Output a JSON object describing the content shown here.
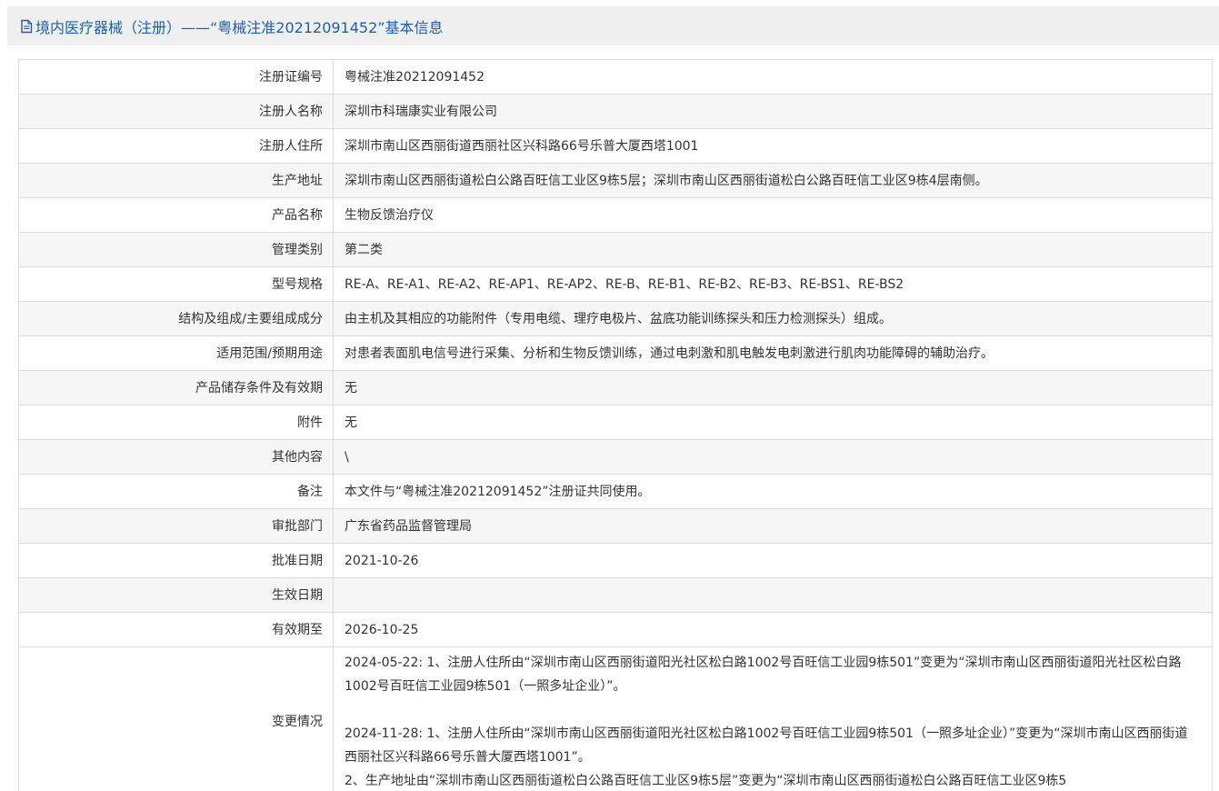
{
  "header": {
    "icon": "document-icon",
    "title": "境内医疗器械（注册）——“粤械注准20212091452”基本信息"
  },
  "rows": [
    {
      "label": "注册证编号",
      "value": "粤械注准20212091452"
    },
    {
      "label": "注册人名称",
      "value": "深圳市科瑞康实业有限公司"
    },
    {
      "label": "注册人住所",
      "value": "深圳市南山区西丽街道西丽社区兴科路66号乐普大厦西塔1001"
    },
    {
      "label": "生产地址",
      "value": "深圳市南山区西丽街道松白公路百旺信工业区9栋5层；深圳市南山区西丽街道松白公路百旺信工业区9栋4层南侧。"
    },
    {
      "label": "产品名称",
      "value": "生物反馈治疗仪"
    },
    {
      "label": "管理类别",
      "value": "第二类"
    },
    {
      "label": "型号规格",
      "value": "RE-A、RE-A1、RE-A2、RE-AP1、RE-AP2、RE-B、RE-B1、RE-B2、RE-B3、RE-BS1、RE-BS2"
    },
    {
      "label": "结构及组成/主要组成成分",
      "value": "由主机及其相应的功能附件（专用电缆、理疗电极片、盆底功能训练探头和压力检测探头）组成。"
    },
    {
      "label": "适用范围/预期用途",
      "value": "对患者表面肌电信号进行采集、分析和生物反馈训练，通过电刺激和肌电触发电刺激进行肌肉功能障碍的辅助治疗。"
    },
    {
      "label": "产品储存条件及有效期",
      "value": "无"
    },
    {
      "label": "附件",
      "value": "无"
    },
    {
      "label": "其他内容",
      "value": "\\"
    },
    {
      "label": "备注",
      "value": "本文件与“粤械注准20212091452”注册证共同使用。"
    },
    {
      "label": "审批部门",
      "value": "广东省药品监督管理局"
    },
    {
      "label": "批准日期",
      "value": "2021-10-26"
    },
    {
      "label": "生效日期",
      "value": ""
    },
    {
      "label": "有效期至",
      "value": "2026-10-25"
    }
  ],
  "changes": {
    "label": "变更情况",
    "entries": [
      "2024-05-22: 1、注册人住所由“深圳市南山区西丽街道阳光社区松白路1002号百旺信工业园9栋501”变更为“深圳市南山区西丽街道阳光社区松白路1002号百旺信工业园9栋501（一照多址企业）”。",
      "2024-11-28: 1、注册人住所由“深圳市南山区西丽街道阳光社区松白路1002号百旺信工业园9栋501（一照多址企业）”变更为“深圳市南山区西丽街道西丽社区兴科路66号乐普大厦西塔1001”。",
      "2、生产地址由“深圳市南山区西丽街道松白公路百旺信工业区9栋5层”变更为“深圳市南山区西丽街道松白公路百旺信工业区9栋5"
    ]
  }
}
